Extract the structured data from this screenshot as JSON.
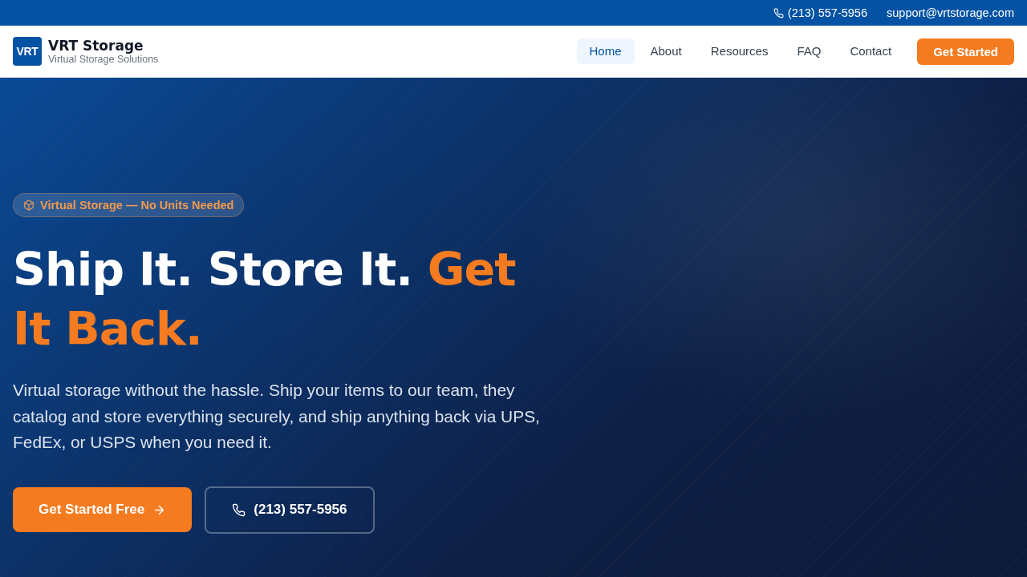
{
  "top_bar": {
    "phone": "(213) 557-5956",
    "email": "support@vrtstorage.com"
  },
  "header": {
    "logo_mark": "VRT",
    "brand_name": "VRT Storage",
    "tagline": "Virtual Storage Solutions",
    "nav": [
      {
        "label": "Home",
        "selected": true
      },
      {
        "label": "About",
        "selected": false
      },
      {
        "label": "Resources",
        "selected": false
      },
      {
        "label": "FAQ",
        "selected": false
      },
      {
        "label": "Contact",
        "selected": false
      }
    ],
    "cta": "Get Started"
  },
  "hero": {
    "badge": "Virtual Storage — No Units Needed",
    "headline": "Ship It. Store It.",
    "headline_accent": "Get It Back.",
    "description": "Virtual storage without the hassle. Ship your items to our team, they catalog and store everything securely, and ship anything back via UPS, FedEx, or USPS when you need it.",
    "buttons": [
      {
        "kind": "primary",
        "label": "Get Started Free"
      },
      {
        "kind": "outline",
        "label": "(213) 557-5956"
      }
    ]
  }
}
